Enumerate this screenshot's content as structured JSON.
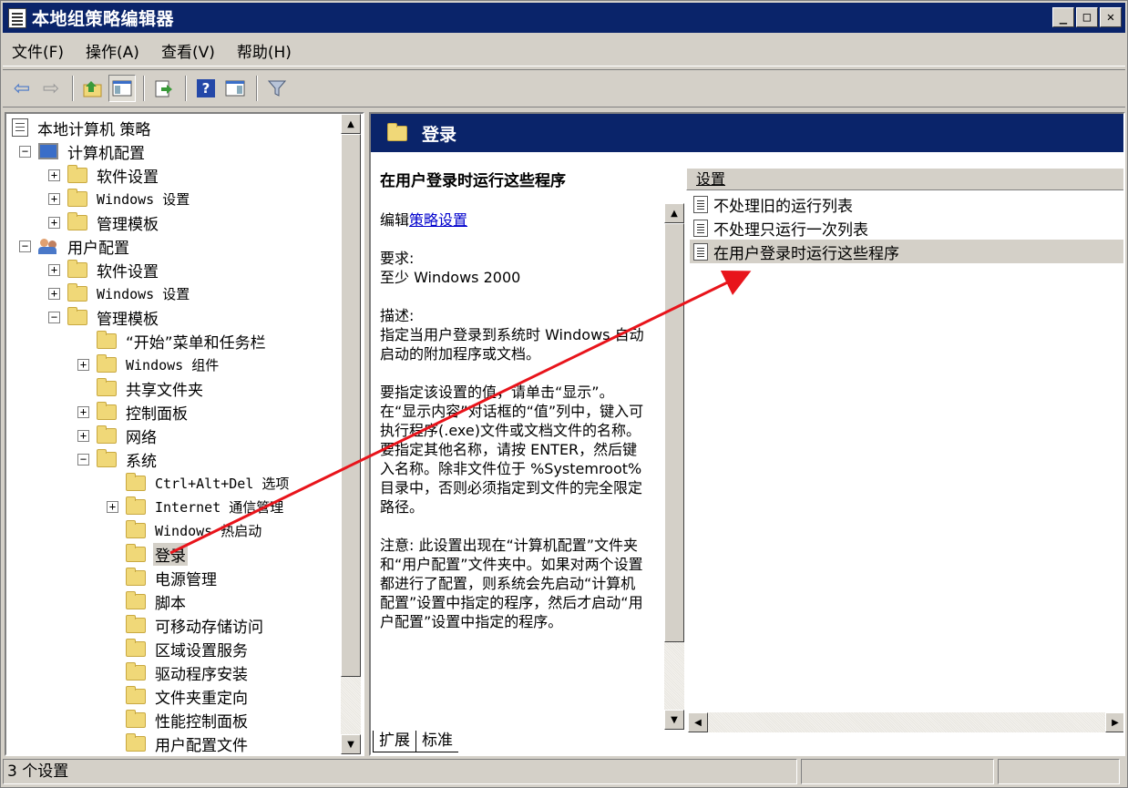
{
  "window": {
    "title": "本地组策略编辑器",
    "minimize": "_",
    "maximize": "□",
    "close": "✕"
  },
  "menu": {
    "file": "文件(F)",
    "action": "操作(A)",
    "view": "查看(V)",
    "help": "帮助(H)"
  },
  "toolbar": {
    "help_glyph": "?"
  },
  "tree": {
    "root": "本地计算机 策略",
    "computer_config": "计算机配置",
    "cc_software": "软件设置",
    "cc_windows": "Windows 设置",
    "cc_admin": "管理模板",
    "user_config": "用户配置",
    "uc_software": "软件设置",
    "uc_windows": "Windows 设置",
    "uc_admin": "管理模板",
    "start_menu": "“开始”菜单和任务栏",
    "windows_components": "Windows 组件",
    "shared_folders": "共享文件夹",
    "control_panel": "控制面板",
    "network": "网络",
    "system": "系统",
    "ctrl_alt_del": "Ctrl+Alt+Del 选项",
    "internet_comm": "Internet 通信管理",
    "windows_hotstart": "Windows 热启动",
    "logon": "登录",
    "power": "电源管理",
    "scripts": "脚本",
    "removable_storage": "可移动存储访问",
    "locale_services": "区域设置服务",
    "driver_install": "驱动程序安装",
    "folder_redirection": "文件夹重定向",
    "perf_control_panel": "性能控制面板",
    "user_profiles": "用户配置文件",
    "expander_plus": "+",
    "expander_minus": "−"
  },
  "header": {
    "title": "登录"
  },
  "description": {
    "title": "在用户登录时运行这些程序",
    "edit_prefix": "编辑",
    "edit_link": "策略设置",
    "requirements": "要求:\n至少 Windows 2000",
    "desc": "描述:\n指定当用户登录到系统时 Windows 自动启动的附加程序或文档。",
    "how": "要指定该设置的值，请单击“显示”。在“显示内容”对话框的“值”列中，键入可执行程序(.exe)文件或文档文件的名称。要指定其他名称，请按 ENTER，然后键入名称。除非文件位于 %Systemroot% 目录中，否则必须指定到文件的完全限定路径。",
    "note": "注意: 此设置出现在“计算机配置”文件夹和“用户配置”文件夹中。如果对两个设置都进行了配置，则系统会先启动“计算机配置”设置中指定的程序，然后才启动“用户配置”设置中指定的程序。"
  },
  "list": {
    "column_header": "设置",
    "items": [
      "不处理旧的运行列表",
      "不处理只运行一次列表",
      "在用户登录时运行这些程序"
    ]
  },
  "tabs": {
    "extended": "扩展",
    "standard": "标准"
  },
  "status": {
    "text": "3 个设置"
  },
  "colors": {
    "titlebar": "#0a246a",
    "chrome": "#d4d0c8",
    "annotation_arrow": "#e8141b"
  }
}
